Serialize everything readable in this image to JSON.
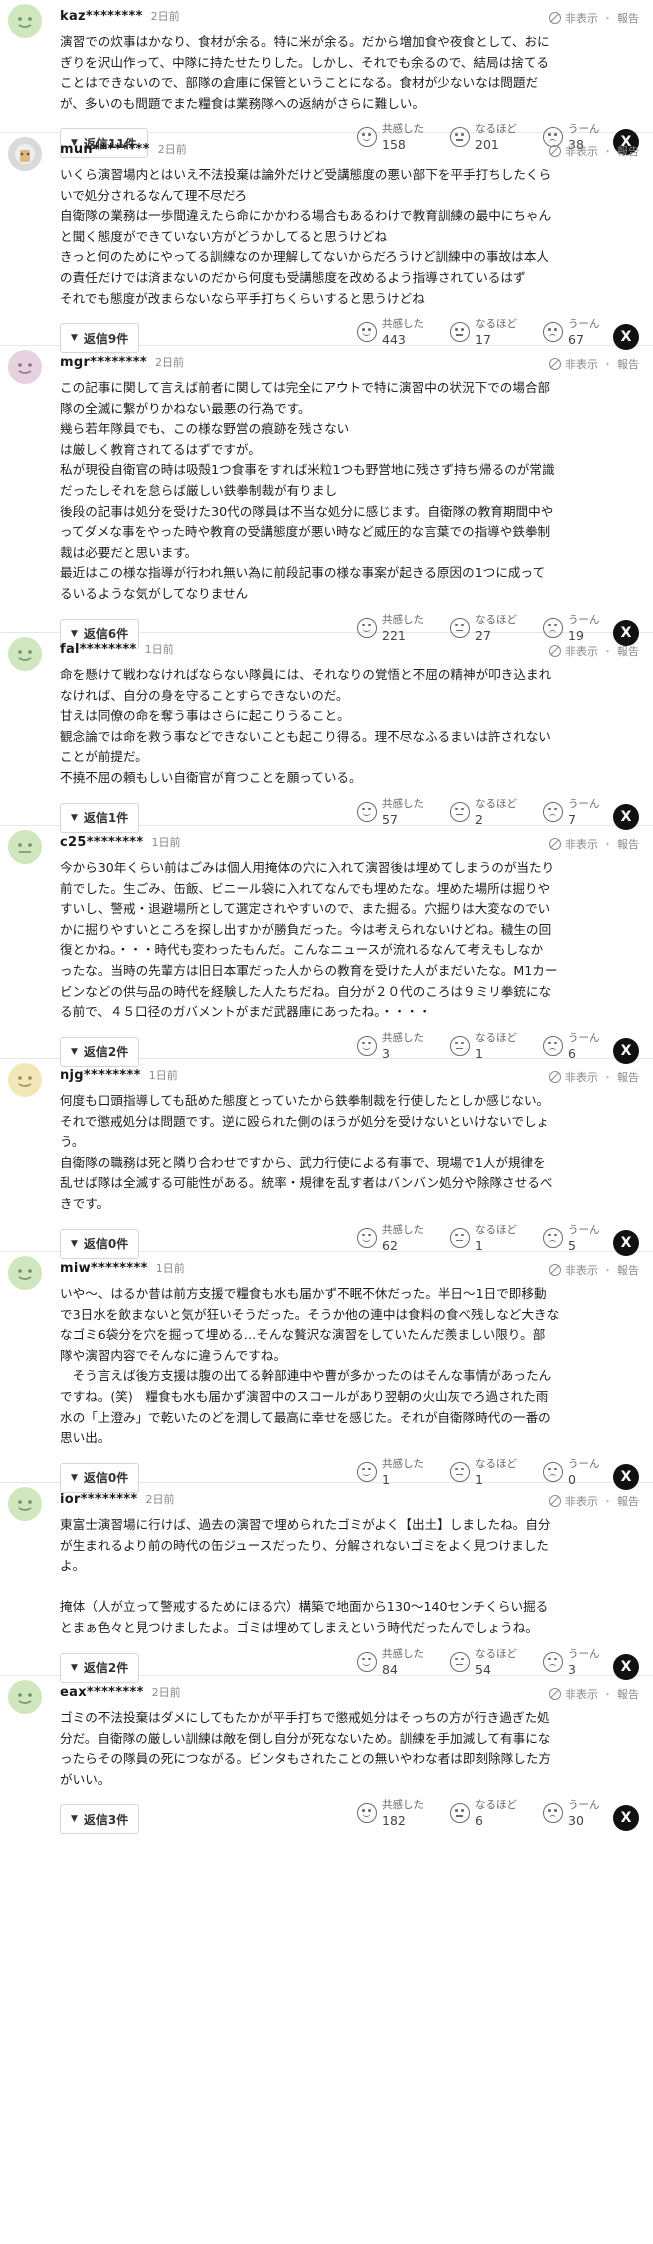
{
  "ui": {
    "hide_label": "非表示",
    "separator": "・",
    "report_label": "報告",
    "reaction_labels": [
      "共感した",
      "なるほど",
      "うーん"
    ],
    "share_x_label": "X"
  },
  "comments": [
    {
      "username": "kaz********",
      "time": "2日前",
      "lines": [
        "演習での炊事はかなり、食材が余る。特に米が余る。だから増加食や夜食として、おに",
        "ぎりを沢山作って、中隊に持たせたりした。しかし、それでも余るので、結局は捨てる",
        "ことはできないので、部隊の倉庫に保管ということになる。食材が少ないなは問題だ",
        "が、多いのも問題でまた糧食は業務隊への返納がさらに難しい。"
      ],
      "reply": "返信11件",
      "counts": [
        "158",
        "201",
        "38"
      ],
      "avatar": "#cfe6bf"
    },
    {
      "username": "mun********",
      "time": "2日前",
      "lines": [
        "いくら演習場内とはいえ不法投棄は論外だけど受講態度の悪い部下を平手打ちしたくら",
        "いで処分されるなんて理不尽だろ",
        "自衛隊の業務は一歩間違えたら命にかかわる場合もあるわけで教育訓練の最中にちゃん",
        "と聞く態度ができていない方がどうかしてると思うけどね",
        "きっと何のためにやってる訓練なのか理解してないからだろうけど訓練中の事故は本人",
        "の責任だけでは済まないのだから何度も受講態度を改めるよう指導されているはず",
        "それでも態度が改まらないなら平手打ちくらいすると思うけどね"
      ],
      "reply": "返信9件",
      "counts": [
        "443",
        "17",
        "67"
      ],
      "avatar": "#d9d9d9"
    },
    {
      "username": "mgr********",
      "time": "2日前",
      "lines": [
        "この記事に関して言えば前者に関しては完全にアウトで特に演習中の状況下での場合部",
        "隊の全滅に繋がりかねない最悪の行為です。",
        "幾ら若年隊員でも、この様な野営の痕跡を残さない",
        "は厳しく教育されてるはずですが。",
        "私が現役自衛官の時は吸殻1つ食事をすれば米粒1つも野営地に残さず持ち帰るのが常識",
        "だったしそれを怠らば厳しい鉄拳制裁が有りまし",
        "後段の記事は処分を受けた30代の隊員は不当な処分に感じます。自衛隊の教育期間中や",
        "ってダメな事をやった時や教育の受講態度が悪い時など威圧的な言葉での指導や鉄拳制",
        "裁は必要だと思います。",
        "最近はこの様な指導が行われ無い為に前段記事の様な事案が起きる原因の1つに成って",
        "るいるような気がしてなりません"
      ],
      "reply": "返信6件",
      "counts": [
        "221",
        "27",
        "19"
      ],
      "avatar": "#e7d2e0"
    },
    {
      "username": "fal********",
      "time": "1日前",
      "lines": [
        "命を懸けて戦わなければならない隊員には、それなりの覚悟と不屈の精神が叩き込まれ",
        "なければ、自分の身を守ることすらできないのだ。",
        "甘えは同僚の命を奪う事はさらに起こりうること。",
        "観念論では命を救う事などできないことも起こり得る。理不尽なふるまいは許されない",
        "ことが前提だ。",
        "不撓不屈の頼もしい自衛官が育つことを願っている。"
      ],
      "reply": "返信1件",
      "counts": [
        "57",
        "2",
        "7"
      ],
      "avatar": "#cfe6bf"
    },
    {
      "username": "c25********",
      "time": "1日前",
      "lines": [
        "今から30年くらい前はごみは個人用掩体の穴に入れて演習後は埋めてしまうのが当たり",
        "前でした。生ごみ、缶飯、ビニール袋に入れてなんでも埋めたな。埋めた場所は掘りや",
        "すいし、警戒・退避場所として選定されやすいので、また掘る。穴掘りは大変なのでい",
        "かに掘りやすいところを探し出すかが勝負だった。今は考えられないけどね。穢生の回",
        "復とかね。・・・時代も変わったもんだ。こんなニュースが流れるなんて考えもしなか",
        "ったな。当時の先輩方は旧日本軍だった人からの教育を受けた人がまだいたな。M1カー",
        "ビンなどの供与品の時代を経験した人たちだね。自分が２０代のころは９ミリ拳銃にな",
        "る前で、４５口径のガバメントがまだ武器庫にあったね。・・・・"
      ],
      "reply": "返信2件",
      "counts": [
        "3",
        "1",
        "6"
      ],
      "avatar": "#cfe6bf"
    },
    {
      "username": "njg********",
      "time": "1日前",
      "lines": [
        "何度も口頭指導しても舐めた態度とっていたから鉄拳制裁を行使したとしか感じない。",
        "それで懲戒処分は問題です。逆に殴られた側のほうが処分を受けないといけないでしょ",
        "う。",
        "自衛隊の職務は死と隣り合わせですから、武力行使による有事で、現場で1人が規律を",
        "乱せば隊は全滅する可能性がある。統率・規律を乱す者はバンバン処分や除隊させるべ",
        "きです。"
      ],
      "reply": "返信0件",
      "counts": [
        "62",
        "1",
        "5"
      ],
      "avatar": "#f1e7b8"
    },
    {
      "username": "miw********",
      "time": "1日前",
      "lines": [
        "いや～、はるか昔は前方支援で糧食も水も届かず不眠不休だった。半日～1日で即移動",
        "で3日水を飲まないと気が狂いそうだった。そうか他の連中は食料の食べ残しなど大きな",
        "なゴミ6袋分を穴を掘って埋める…そんな贅沢な演習をしていたんだ羨ましい限り。部",
        "隊や演習内容でそんなに違うんですね。",
        "　そう言えば後方支援は腹の出てる幹部連中や曹が多かったのはそんな事情があったん",
        "ですね。(笑)　糧食も水も届かず演習中のスコールがあり翌朝の火山灰でろ過された雨",
        "水の「上澄み」で乾いたのどを潤して最高に幸せを感じた。それが自衛隊時代の一番の",
        "思い出。"
      ],
      "reply": "返信0件",
      "counts": [
        "1",
        "1",
        "0"
      ],
      "avatar": "#cfe6bf"
    },
    {
      "username": "ior********",
      "time": "2日前",
      "lines": [
        "東富士演習場に行けば、過去の演習で埋められたゴミがよく【出土】しましたね。自分",
        "が生まれるより前の時代の缶ジュースだったり、分解されないゴミをよく見つけました",
        "よ。",
        "",
        "掩体（人が立って警戒するためにほる穴）構築で地面から130～140センチくらい掘る",
        "とまぁ色々と見つけましたよ。ゴミは埋めてしまえという時代だったんでしょうね。"
      ],
      "reply": "返信2件",
      "counts": [
        "84",
        "54",
        "3"
      ],
      "avatar": "#cfe6bf"
    },
    {
      "username": "eax********",
      "time": "2日前",
      "lines": [
        "ゴミの不法投棄はダメにしてもたかが平手打ちで懲戒処分はそっちの方が行き過ぎた処",
        "分だ。自衛隊の厳しい訓練は敵を倒し自分が死なないため。訓練を手加減して有事にな",
        "ったらその隊員の死につながる。ビンタもされたことの無いやわな者は即刻除隊した方",
        "がいい。"
      ],
      "reply": "返信3件",
      "counts": [
        "182",
        "6",
        "30"
      ],
      "avatar": "#cfe6bf"
    }
  ]
}
